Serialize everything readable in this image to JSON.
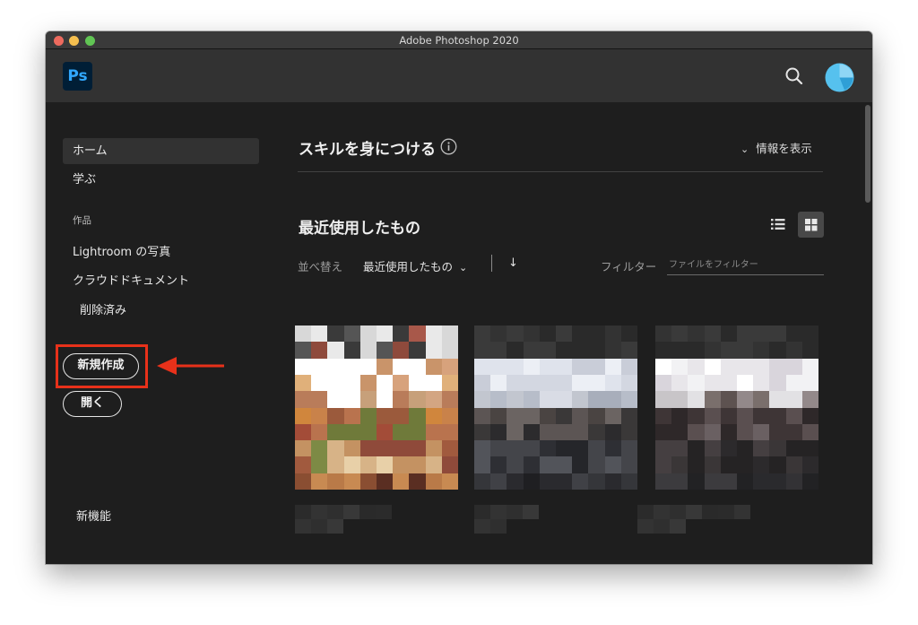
{
  "window": {
    "title": "Adobe Photoshop 2020"
  },
  "app": {
    "logo": "Ps"
  },
  "header": {
    "search_icon": "search-icon",
    "avatar_icon": "avatar"
  },
  "sidebar": {
    "home": "ホーム",
    "learn": "学ぶ",
    "section_works": "作品",
    "lightroom": "Lightroom の写真",
    "cloud_docs": "クラウドドキュメント",
    "deleted": "削除済み",
    "new_button": "新規作成",
    "open_button": "開く",
    "whats_new": "新機能"
  },
  "main": {
    "skills_title": "スキルを身につける",
    "show_info": "情報を表示",
    "recent_title": "最近使用したもの",
    "sort_label": "並べ替え",
    "sort_value": "最近使用したもの",
    "sort_direction": "↓",
    "filter_label": "フィルター",
    "filter_placeholder": "ファイルをフィルター"
  },
  "colors": {
    "highlight": "#e8311a",
    "accent": "#31a8ff"
  }
}
